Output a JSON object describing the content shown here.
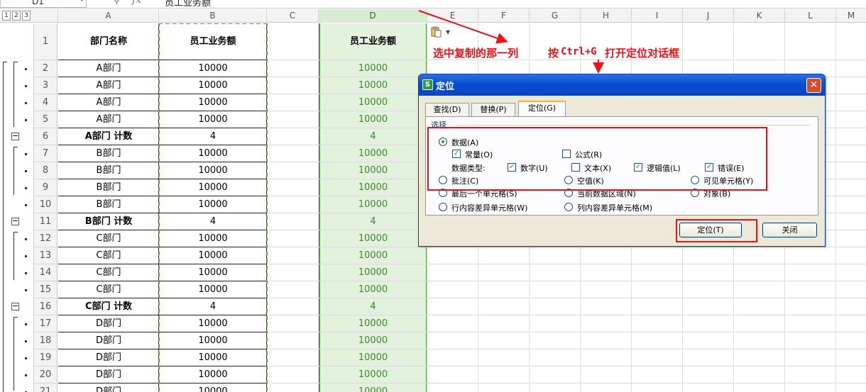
{
  "formula_bar": {
    "name_box": "D1",
    "formula": "员工业务额"
  },
  "outline_levels": [
    "1",
    "2",
    "3"
  ],
  "columns": [
    "A",
    "B",
    "C",
    "D",
    "E",
    "F",
    "G",
    "H",
    "I",
    "J",
    "K",
    "L",
    "M"
  ],
  "rows": [
    {
      "n": "1",
      "a": "部门名称",
      "b": "员工业务额",
      "d": "员工业务额",
      "header": true
    },
    {
      "n": "2",
      "a": "A部门",
      "b": "10000",
      "d": "10000"
    },
    {
      "n": "3",
      "a": "A部门",
      "b": "10000",
      "d": "10000"
    },
    {
      "n": "4",
      "a": "A部门",
      "b": "10000",
      "d": "10000"
    },
    {
      "n": "5",
      "a": "A部门",
      "b": "10000",
      "d": "10000"
    },
    {
      "n": "6",
      "a": "A部门  计数",
      "b": "4",
      "d": "4",
      "subtotal": true
    },
    {
      "n": "7",
      "a": "B部门",
      "b": "10000",
      "d": "10000"
    },
    {
      "n": "8",
      "a": "B部门",
      "b": "10000",
      "d": "10000"
    },
    {
      "n": "9",
      "a": "B部门",
      "b": "10000",
      "d": "10000"
    },
    {
      "n": "10",
      "a": "B部门",
      "b": "10000",
      "d": "10000"
    },
    {
      "n": "11",
      "a": "B部门  计数",
      "b": "4",
      "d": "4",
      "subtotal": true
    },
    {
      "n": "12",
      "a": "C部门",
      "b": "10000",
      "d": "10000"
    },
    {
      "n": "13",
      "a": "C部门",
      "b": "10000",
      "d": "10000"
    },
    {
      "n": "14",
      "a": "C部门",
      "b": "10000",
      "d": "10000"
    },
    {
      "n": "15",
      "a": "C部门",
      "b": "10000",
      "d": "10000"
    },
    {
      "n": "16",
      "a": "C部门  计数",
      "b": "4",
      "d": "4",
      "subtotal": true
    },
    {
      "n": "17",
      "a": "D部门",
      "b": "10000",
      "d": "10000"
    },
    {
      "n": "18",
      "a": "D部门",
      "b": "10000",
      "d": "10000"
    },
    {
      "n": "19",
      "a": "D部门",
      "b": "10000",
      "d": "10000"
    },
    {
      "n": "20",
      "a": "D部门",
      "b": "10000",
      "d": "10000"
    },
    {
      "n": "21",
      "a": "D部门",
      "b": "10000",
      "d": "10000"
    }
  ],
  "annotations": {
    "step1": "选中复制的那一列",
    "step2_prefix": "按",
    "step2_keys": "Ctrl+G",
    "step2_suffix": "打开定位对话框"
  },
  "dialog": {
    "title": "定位",
    "app_icon": "S",
    "close_glyph": "✕",
    "tabs": [
      "查找(D)",
      "替换(P)",
      "定位(G)"
    ],
    "active_tab": "定位(G)",
    "group_label": "选择",
    "options": {
      "data": "数据(A)",
      "constants": "常量(O)",
      "formulas": "公式(R)",
      "data_type_label": "数据类型:",
      "numbers": "数字(U)",
      "text": "文本(X)",
      "logicals": "逻辑值(L)",
      "errors": "错误(E)",
      "comments": "批注(C)",
      "blanks": "空值(K)",
      "visible_cells": "可见单元格(Y)",
      "last_cell": "最后一个单元格(S)",
      "current_region": "当前数据区域(N)",
      "objects": "对象(B)",
      "row_differences": "行内容差异单元格(W)",
      "column_differences": "列内容差异单元格(M)"
    },
    "selected_option": "数据(A)",
    "checked": [
      "常量(O)",
      "数字(U)",
      "逻辑值(L)",
      "错误(E)"
    ],
    "buttons": {
      "goto": "定位(T)",
      "close": "关闭"
    }
  },
  "colors": {
    "annotation_red": "#e8141a",
    "selection_green": "#4f9a3d",
    "title_blue": "#0a4fd1"
  }
}
